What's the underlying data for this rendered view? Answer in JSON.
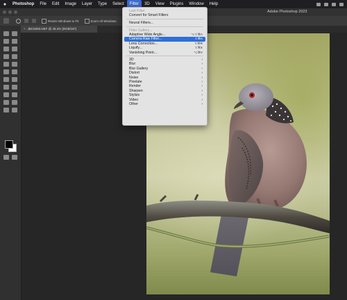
{
  "menubar": {
    "apple": "",
    "items": [
      "Photoshop",
      "File",
      "Edit",
      "Image",
      "Layer",
      "Type",
      "Select",
      "Filter",
      "3D",
      "View",
      "Plugins",
      "Window",
      "Help"
    ],
    "active_index": 7
  },
  "app": {
    "title": "Adobe Photoshop 2023"
  },
  "options_bar": {
    "resize_windows_label": "Resize Windows to Fit",
    "zoom_all_label": "Zoom All Windows"
  },
  "document": {
    "tab_label": "JBC5050.NEF @ 45.4% (RGB/16*)",
    "close_glyph": "×"
  },
  "filter_menu": {
    "last_filter": "Last Filter",
    "convert_smart": "Convert for Smart Filters",
    "neural": "Neural Filters...",
    "filter_gallery": "Filter Gallery...",
    "adaptive": {
      "label": "Adaptive Wide Angle...",
      "shortcut": "⌥⇧⌘A"
    },
    "camera_raw": {
      "label": "Camera Raw Filter...",
      "shortcut": "⇧⌘A"
    },
    "lens": {
      "label": "Lens Correction...",
      "shortcut": "⇧⌘R"
    },
    "liquify": {
      "label": "Liquify...",
      "shortcut": "⇧⌘X"
    },
    "vanishing": {
      "label": "Vanishing Point...",
      "shortcut": "⌥⌘V"
    },
    "submenus": [
      "3D",
      "Blur",
      "Blur Gallery",
      "Distort",
      "Noise",
      "Pixelate",
      "Render",
      "Sharpen",
      "Stylize",
      "Video",
      "Other"
    ],
    "arrow": "›"
  },
  "colors": {
    "menu_highlight": "#2f6fd8",
    "canvas_bg": "#262626",
    "menubar_bg": "#1f1f22"
  }
}
